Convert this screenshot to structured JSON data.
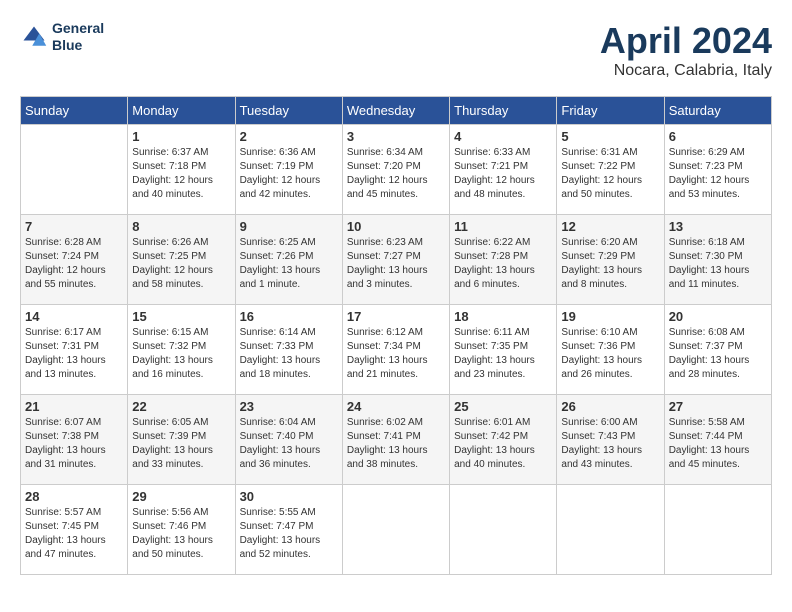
{
  "header": {
    "logo_line1": "General",
    "logo_line2": "Blue",
    "month_year": "April 2024",
    "location": "Nocara, Calabria, Italy"
  },
  "weekdays": [
    "Sunday",
    "Monday",
    "Tuesday",
    "Wednesday",
    "Thursday",
    "Friday",
    "Saturday"
  ],
  "weeks": [
    [
      {
        "day": "",
        "sunrise": "",
        "sunset": "",
        "daylight": ""
      },
      {
        "day": "1",
        "sunrise": "Sunrise: 6:37 AM",
        "sunset": "Sunset: 7:18 PM",
        "daylight": "Daylight: 12 hours and 40 minutes."
      },
      {
        "day": "2",
        "sunrise": "Sunrise: 6:36 AM",
        "sunset": "Sunset: 7:19 PM",
        "daylight": "Daylight: 12 hours and 42 minutes."
      },
      {
        "day": "3",
        "sunrise": "Sunrise: 6:34 AM",
        "sunset": "Sunset: 7:20 PM",
        "daylight": "Daylight: 12 hours and 45 minutes."
      },
      {
        "day": "4",
        "sunrise": "Sunrise: 6:33 AM",
        "sunset": "Sunset: 7:21 PM",
        "daylight": "Daylight: 12 hours and 48 minutes."
      },
      {
        "day": "5",
        "sunrise": "Sunrise: 6:31 AM",
        "sunset": "Sunset: 7:22 PM",
        "daylight": "Daylight: 12 hours and 50 minutes."
      },
      {
        "day": "6",
        "sunrise": "Sunrise: 6:29 AM",
        "sunset": "Sunset: 7:23 PM",
        "daylight": "Daylight: 12 hours and 53 minutes."
      }
    ],
    [
      {
        "day": "7",
        "sunrise": "Sunrise: 6:28 AM",
        "sunset": "Sunset: 7:24 PM",
        "daylight": "Daylight: 12 hours and 55 minutes."
      },
      {
        "day": "8",
        "sunrise": "Sunrise: 6:26 AM",
        "sunset": "Sunset: 7:25 PM",
        "daylight": "Daylight: 12 hours and 58 minutes."
      },
      {
        "day": "9",
        "sunrise": "Sunrise: 6:25 AM",
        "sunset": "Sunset: 7:26 PM",
        "daylight": "Daylight: 13 hours and 1 minute."
      },
      {
        "day": "10",
        "sunrise": "Sunrise: 6:23 AM",
        "sunset": "Sunset: 7:27 PM",
        "daylight": "Daylight: 13 hours and 3 minutes."
      },
      {
        "day": "11",
        "sunrise": "Sunrise: 6:22 AM",
        "sunset": "Sunset: 7:28 PM",
        "daylight": "Daylight: 13 hours and 6 minutes."
      },
      {
        "day": "12",
        "sunrise": "Sunrise: 6:20 AM",
        "sunset": "Sunset: 7:29 PM",
        "daylight": "Daylight: 13 hours and 8 minutes."
      },
      {
        "day": "13",
        "sunrise": "Sunrise: 6:18 AM",
        "sunset": "Sunset: 7:30 PM",
        "daylight": "Daylight: 13 hours and 11 minutes."
      }
    ],
    [
      {
        "day": "14",
        "sunrise": "Sunrise: 6:17 AM",
        "sunset": "Sunset: 7:31 PM",
        "daylight": "Daylight: 13 hours and 13 minutes."
      },
      {
        "day": "15",
        "sunrise": "Sunrise: 6:15 AM",
        "sunset": "Sunset: 7:32 PM",
        "daylight": "Daylight: 13 hours and 16 minutes."
      },
      {
        "day": "16",
        "sunrise": "Sunrise: 6:14 AM",
        "sunset": "Sunset: 7:33 PM",
        "daylight": "Daylight: 13 hours and 18 minutes."
      },
      {
        "day": "17",
        "sunrise": "Sunrise: 6:12 AM",
        "sunset": "Sunset: 7:34 PM",
        "daylight": "Daylight: 13 hours and 21 minutes."
      },
      {
        "day": "18",
        "sunrise": "Sunrise: 6:11 AM",
        "sunset": "Sunset: 7:35 PM",
        "daylight": "Daylight: 13 hours and 23 minutes."
      },
      {
        "day": "19",
        "sunrise": "Sunrise: 6:10 AM",
        "sunset": "Sunset: 7:36 PM",
        "daylight": "Daylight: 13 hours and 26 minutes."
      },
      {
        "day": "20",
        "sunrise": "Sunrise: 6:08 AM",
        "sunset": "Sunset: 7:37 PM",
        "daylight": "Daylight: 13 hours and 28 minutes."
      }
    ],
    [
      {
        "day": "21",
        "sunrise": "Sunrise: 6:07 AM",
        "sunset": "Sunset: 7:38 PM",
        "daylight": "Daylight: 13 hours and 31 minutes."
      },
      {
        "day": "22",
        "sunrise": "Sunrise: 6:05 AM",
        "sunset": "Sunset: 7:39 PM",
        "daylight": "Daylight: 13 hours and 33 minutes."
      },
      {
        "day": "23",
        "sunrise": "Sunrise: 6:04 AM",
        "sunset": "Sunset: 7:40 PM",
        "daylight": "Daylight: 13 hours and 36 minutes."
      },
      {
        "day": "24",
        "sunrise": "Sunrise: 6:02 AM",
        "sunset": "Sunset: 7:41 PM",
        "daylight": "Daylight: 13 hours and 38 minutes."
      },
      {
        "day": "25",
        "sunrise": "Sunrise: 6:01 AM",
        "sunset": "Sunset: 7:42 PM",
        "daylight": "Daylight: 13 hours and 40 minutes."
      },
      {
        "day": "26",
        "sunrise": "Sunrise: 6:00 AM",
        "sunset": "Sunset: 7:43 PM",
        "daylight": "Daylight: 13 hours and 43 minutes."
      },
      {
        "day": "27",
        "sunrise": "Sunrise: 5:58 AM",
        "sunset": "Sunset: 7:44 PM",
        "daylight": "Daylight: 13 hours and 45 minutes."
      }
    ],
    [
      {
        "day": "28",
        "sunrise": "Sunrise: 5:57 AM",
        "sunset": "Sunset: 7:45 PM",
        "daylight": "Daylight: 13 hours and 47 minutes."
      },
      {
        "day": "29",
        "sunrise": "Sunrise: 5:56 AM",
        "sunset": "Sunset: 7:46 PM",
        "daylight": "Daylight: 13 hours and 50 minutes."
      },
      {
        "day": "30",
        "sunrise": "Sunrise: 5:55 AM",
        "sunset": "Sunset: 7:47 PM",
        "daylight": "Daylight: 13 hours and 52 minutes."
      },
      {
        "day": "",
        "sunrise": "",
        "sunset": "",
        "daylight": ""
      },
      {
        "day": "",
        "sunrise": "",
        "sunset": "",
        "daylight": ""
      },
      {
        "day": "",
        "sunrise": "",
        "sunset": "",
        "daylight": ""
      },
      {
        "day": "",
        "sunrise": "",
        "sunset": "",
        "daylight": ""
      }
    ]
  ]
}
